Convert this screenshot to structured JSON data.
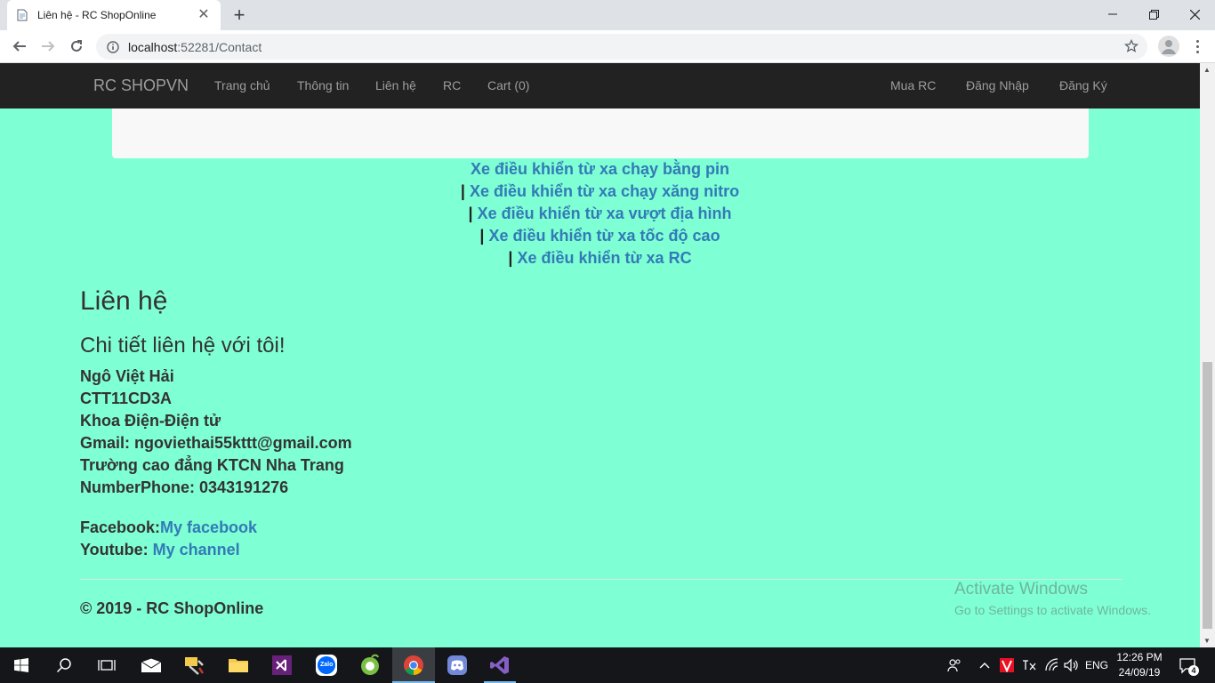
{
  "browser": {
    "tab_title": "Liên hệ - RC ShopOnline",
    "url_host": "localhost",
    "url_path": ":52281/Contact"
  },
  "navbar": {
    "brand": "RC SHOPVN",
    "left_links": [
      "Trang chủ",
      "Thông tin",
      "Liên hệ",
      "RC",
      "Cart (0)"
    ],
    "right_links": [
      "Mua RC",
      "Đăng Nhập",
      "Đăng Ký"
    ]
  },
  "categories": {
    "separator": "|",
    "links": [
      "Xe điều khiển từ xa chạy bằng pin",
      "Xe điều khiển từ xa chạy xăng nitro",
      "Xe điều khiển từ xa vượt địa hình",
      "Xe điều khiển từ xa tốc độ cao",
      "Xe điều khiển từ xa RC"
    ]
  },
  "contact": {
    "heading": "Liên hệ",
    "subheading": "Chi tiết liên hệ với tôi!",
    "name": "Ngô Việt Hải",
    "class": "CTT11CD3A",
    "department": "Khoa Điện-Điện tử",
    "gmail": "Gmail: ngoviethai55kttt@gmail.com",
    "school": "Trường cao đẳng KTCN Nha Trang",
    "phone": "NumberPhone: 0343191276",
    "facebook_label": "Facebook:",
    "facebook_link": "My facebook",
    "youtube_label": "Youtube: ",
    "youtube_link": "My channel"
  },
  "footer": {
    "copyright": "© 2019 - RC ShopOnline"
  },
  "watermark": {
    "line1": "Activate Windows",
    "line2": "Go to Settings to activate Windows."
  },
  "taskbar": {
    "language": "ENG",
    "time": "12:26 PM",
    "date": "24/09/19",
    "notification_count": "4",
    "zalo_label": "Zalo"
  },
  "colors": {
    "page_background": "#7fffd4",
    "navbar_background": "#222222",
    "link": "#337ab7",
    "text": "#333333"
  }
}
